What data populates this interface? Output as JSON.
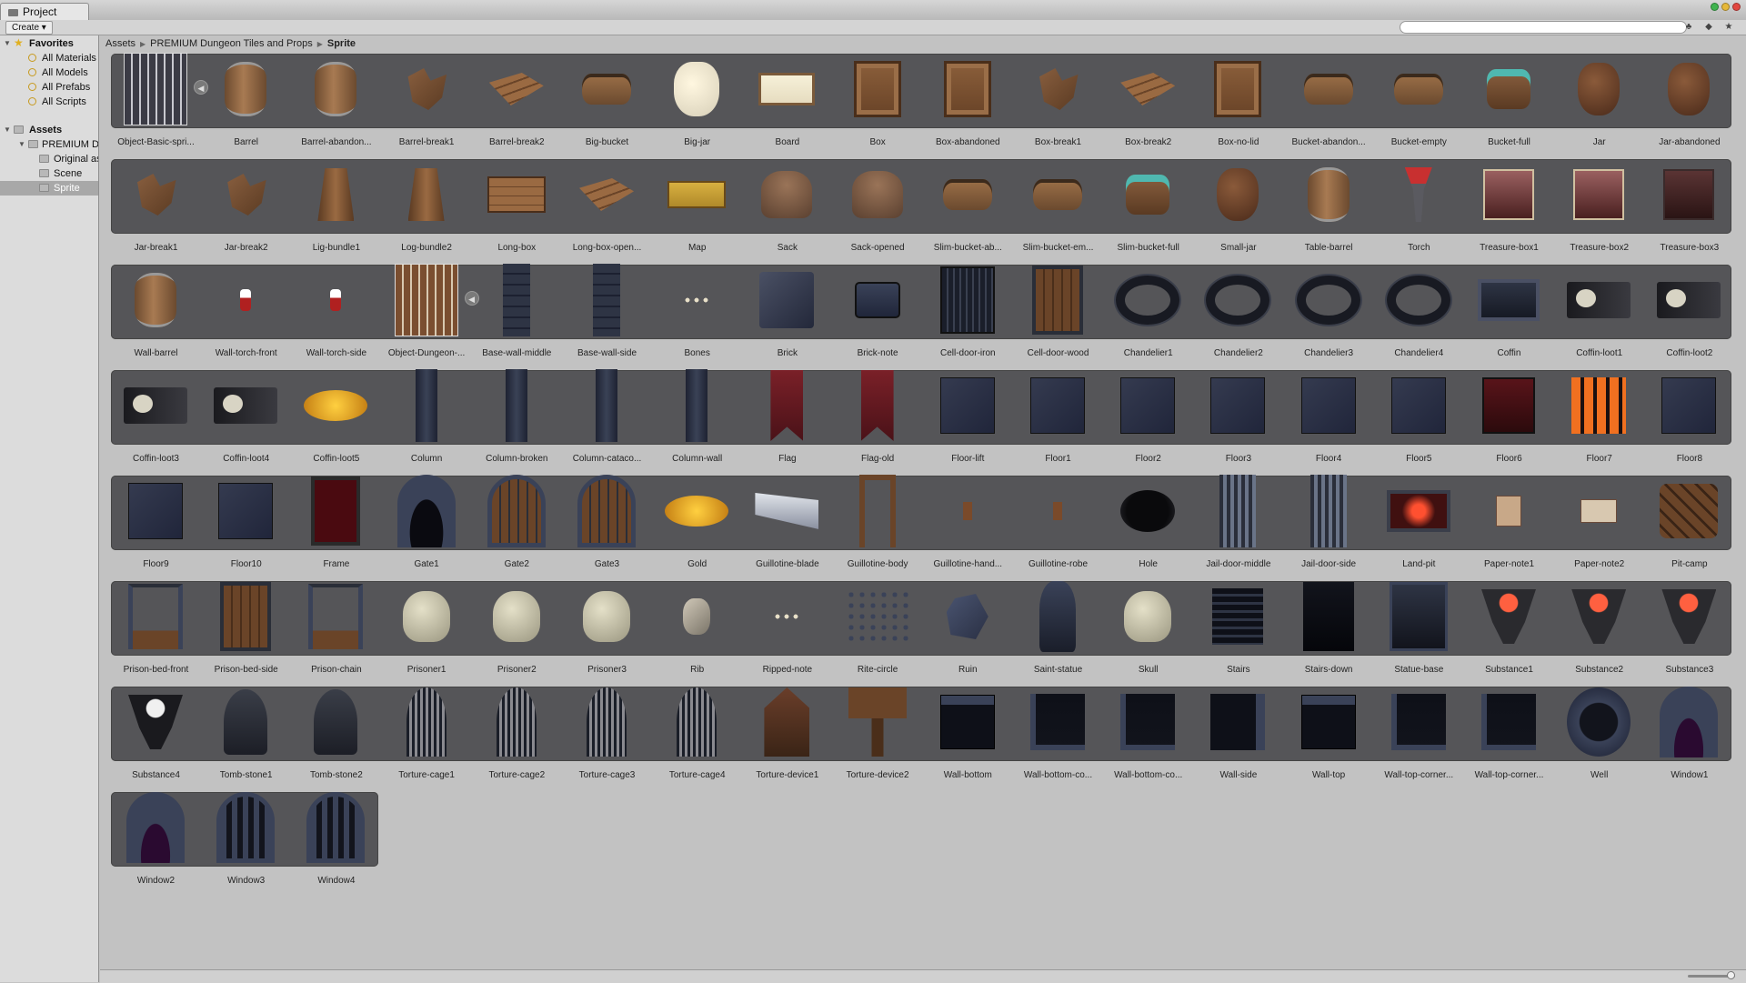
{
  "window": {
    "tab_label": "Project"
  },
  "toolbar": {
    "create_label": "Create ▾",
    "search_value": "",
    "search_placeholder": ""
  },
  "sidebar": {
    "favorites_label": "Favorites",
    "favorites": [
      "All Materials",
      "All Models",
      "All Prefabs",
      "All Scripts"
    ],
    "assets_label": "Assets",
    "folders": [
      {
        "label": "PREMIUM Dungeon Tiles and Props",
        "depth": 1
      },
      {
        "label": "Original assets",
        "depth": 2
      },
      {
        "label": "Scene",
        "depth": 2
      },
      {
        "label": "Sprite",
        "depth": 2,
        "selected": true
      }
    ]
  },
  "breadcrumb": [
    "Assets",
    "PREMIUM Dungeon Tiles and Props",
    "Sprite"
  ],
  "grid": {
    "rows": [
      [
        {
          "label": "Object-Basic-spri...",
          "icon": "sheet"
        },
        {
          "label": "Barrel",
          "icon": "barrel"
        },
        {
          "label": "Barrel-abandon...",
          "icon": "barrel"
        },
        {
          "label": "Barrel-break1",
          "icon": "broken"
        },
        {
          "label": "Barrel-break2",
          "icon": "planks"
        },
        {
          "label": "Big-bucket",
          "icon": "bucket"
        },
        {
          "label": "Big-jar",
          "icon": "jar-w"
        },
        {
          "label": "Board",
          "icon": "board"
        },
        {
          "label": "Box",
          "icon": "box"
        },
        {
          "label": "Box-abandoned",
          "icon": "box"
        },
        {
          "label": "Box-break1",
          "icon": "broken"
        },
        {
          "label": "Box-break2",
          "icon": "planks"
        },
        {
          "label": "Box-no-lid",
          "icon": "box"
        },
        {
          "label": "Bucket-abandon...",
          "icon": "bucket"
        },
        {
          "label": "Bucket-empty",
          "icon": "bucket"
        },
        {
          "label": "Bucket-full",
          "icon": "water"
        },
        {
          "label": "Jar",
          "icon": "jar"
        },
        {
          "label": "Jar-abandoned",
          "icon": "jar"
        }
      ],
      [
        {
          "label": "Jar-break1",
          "icon": "broken"
        },
        {
          "label": "Jar-break2",
          "icon": "broken"
        },
        {
          "label": "Lig-bundle1",
          "icon": "stick"
        },
        {
          "label": "Log-bundle2",
          "icon": "stick"
        },
        {
          "label": "Long-box",
          "icon": "longbox"
        },
        {
          "label": "Long-box-open...",
          "icon": "planks"
        },
        {
          "label": "Map",
          "icon": "map"
        },
        {
          "label": "Sack",
          "icon": "sack"
        },
        {
          "label": "Sack-opened",
          "icon": "sack"
        },
        {
          "label": "Slim-bucket-ab...",
          "icon": "bucket"
        },
        {
          "label": "Slim-bucket-em...",
          "icon": "bucket"
        },
        {
          "label": "Slim-bucket-full",
          "icon": "water"
        },
        {
          "label": "Small-jar",
          "icon": "jar"
        },
        {
          "label": "Table-barrel",
          "icon": "barrel"
        },
        {
          "label": "Torch",
          "icon": "torch"
        },
        {
          "label": "Treasure-box1",
          "icon": "chest"
        },
        {
          "label": "Treasure-box2",
          "icon": "chest"
        },
        {
          "label": "Treasure-box3",
          "icon": "chest-dark"
        }
      ],
      [
        {
          "label": "Wall-barrel",
          "icon": "barrel"
        },
        {
          "label": "Wall-torch-front",
          "icon": "wtorch"
        },
        {
          "label": "Wall-torch-side",
          "icon": "wtorch"
        },
        {
          "label": "Object-Dungeon-...",
          "icon": "sheet2"
        },
        {
          "label": "Base-wall-middle",
          "icon": "pillar"
        },
        {
          "label": "Base-wall-side",
          "icon": "pillar"
        },
        {
          "label": "Bones",
          "icon": "bones"
        },
        {
          "label": "Brick",
          "icon": "stone"
        },
        {
          "label": "Brick-note",
          "icon": "brick"
        },
        {
          "label": "Cell-door-iron",
          "icon": "grate"
        },
        {
          "label": "Cell-door-wood",
          "icon": "door"
        },
        {
          "label": "Chandelier1",
          "icon": "ring"
        },
        {
          "label": "Chandelier2",
          "icon": "ring"
        },
        {
          "label": "Chandelier3",
          "icon": "ring"
        },
        {
          "label": "Chandelier4",
          "icon": "ring"
        },
        {
          "label": "Coffin",
          "icon": "coffin"
        },
        {
          "label": "Coffin-loot1",
          "icon": "loot"
        },
        {
          "label": "Coffin-loot2",
          "icon": "loot"
        }
      ],
      [
        {
          "label": "Coffin-loot3",
          "icon": "loot"
        },
        {
          "label": "Coffin-loot4",
          "icon": "loot"
        },
        {
          "label": "Coffin-loot5",
          "icon": "gold"
        },
        {
          "label": "Column",
          "icon": "column"
        },
        {
          "label": "Column-broken",
          "icon": "column"
        },
        {
          "label": "Column-cataco...",
          "icon": "column"
        },
        {
          "label": "Column-wall",
          "icon": "column"
        },
        {
          "label": "Flag",
          "icon": "flag"
        },
        {
          "label": "Flag-old",
          "icon": "flag"
        },
        {
          "label": "Floor-lift",
          "icon": "floor"
        },
        {
          "label": "Floor1",
          "icon": "floor"
        },
        {
          "label": "Floor2",
          "icon": "floor"
        },
        {
          "label": "Floor3",
          "icon": "floor"
        },
        {
          "label": "Floor4",
          "icon": "floor"
        },
        {
          "label": "Floor5",
          "icon": "floor"
        },
        {
          "label": "Floor6",
          "icon": "floor-red"
        },
        {
          "label": "Floor7",
          "icon": "floor-lava"
        },
        {
          "label": "Floor8",
          "icon": "floor"
        }
      ],
      [
        {
          "label": "Floor9",
          "icon": "floor"
        },
        {
          "label": "Floor10",
          "icon": "floor"
        },
        {
          "label": "Frame",
          "icon": "frame"
        },
        {
          "label": "Gate1",
          "icon": "arch"
        },
        {
          "label": "Gate2",
          "icon": "arch-g"
        },
        {
          "label": "Gate3",
          "icon": "arch-g"
        },
        {
          "label": "Gold",
          "icon": "gold"
        },
        {
          "label": "Guillotine-blade",
          "icon": "blade"
        },
        {
          "label": "Guillotine-body",
          "icon": "gframe"
        },
        {
          "label": "Guillotine-hand...",
          "icon": "small"
        },
        {
          "label": "Guillotine-robe",
          "icon": "small"
        },
        {
          "label": "Hole",
          "icon": "hole"
        },
        {
          "label": "Jail-door-middle",
          "icon": "jail"
        },
        {
          "label": "Jail-door-side",
          "icon": "jail"
        },
        {
          "label": "Land-pit",
          "icon": "pit"
        },
        {
          "label": "Paper-note1",
          "icon": "note"
        },
        {
          "label": "Paper-note2",
          "icon": "note2"
        },
        {
          "label": "Pit-camp",
          "icon": "camp"
        }
      ],
      [
        {
          "label": "Prison-bed-front",
          "icon": "chain"
        },
        {
          "label": "Prison-bed-side",
          "icon": "door"
        },
        {
          "label": "Prison-chain",
          "icon": "chain"
        },
        {
          "label": "Prisoner1",
          "icon": "skull"
        },
        {
          "label": "Prisoner2",
          "icon": "skull"
        },
        {
          "label": "Prisoner3",
          "icon": "skull"
        },
        {
          "label": "Rib",
          "icon": "rope"
        },
        {
          "label": "Ripped-note",
          "icon": "bones"
        },
        {
          "label": "Rite-circle",
          "icon": "rubble"
        },
        {
          "label": "Ruin",
          "icon": "ruin"
        },
        {
          "label": "Saint-statue",
          "icon": "statue"
        },
        {
          "label": "Skull",
          "icon": "skull"
        },
        {
          "label": "Stairs",
          "icon": "stairs"
        },
        {
          "label": "Stairs-down",
          "icon": "stairs-d"
        },
        {
          "label": "Statue-base",
          "icon": "sbase"
        },
        {
          "label": "Substance1",
          "icon": "cauldron"
        },
        {
          "label": "Substance2",
          "icon": "cauldron"
        },
        {
          "label": "Substance3",
          "icon": "cauldron"
        }
      ],
      [
        {
          "label": "Substance4",
          "icon": "cauldron-w"
        },
        {
          "label": "Tomb-stone1",
          "icon": "tomb"
        },
        {
          "label": "Tomb-stone2",
          "icon": "tomb"
        },
        {
          "label": "Torture-cage1",
          "icon": "cage"
        },
        {
          "label": "Torture-cage2",
          "icon": "cage"
        },
        {
          "label": "Torture-cage3",
          "icon": "cage"
        },
        {
          "label": "Torture-cage4",
          "icon": "cage"
        },
        {
          "label": "Torture-device1",
          "icon": "tdev"
        },
        {
          "label": "Torture-device2",
          "icon": "tdev2"
        },
        {
          "label": "Wall-bottom",
          "icon": "wall"
        },
        {
          "label": "Wall-bottom-co...",
          "icon": "wall-c"
        },
        {
          "label": "Wall-bottom-co...",
          "icon": "wall-c"
        },
        {
          "label": "Wall-side",
          "icon": "wall-s"
        },
        {
          "label": "Wall-top",
          "icon": "wall"
        },
        {
          "label": "Wall-top-corner...",
          "icon": "wall-c"
        },
        {
          "label": "Wall-top-corner...",
          "icon": "wall-c"
        },
        {
          "label": "Well",
          "icon": "well"
        },
        {
          "label": "Window1",
          "icon": "window"
        }
      ],
      [
        {
          "label": "Window2",
          "icon": "window"
        },
        {
          "label": "Window3",
          "icon": "window-bars"
        },
        {
          "label": "Window4",
          "icon": "window-bars"
        }
      ]
    ]
  }
}
